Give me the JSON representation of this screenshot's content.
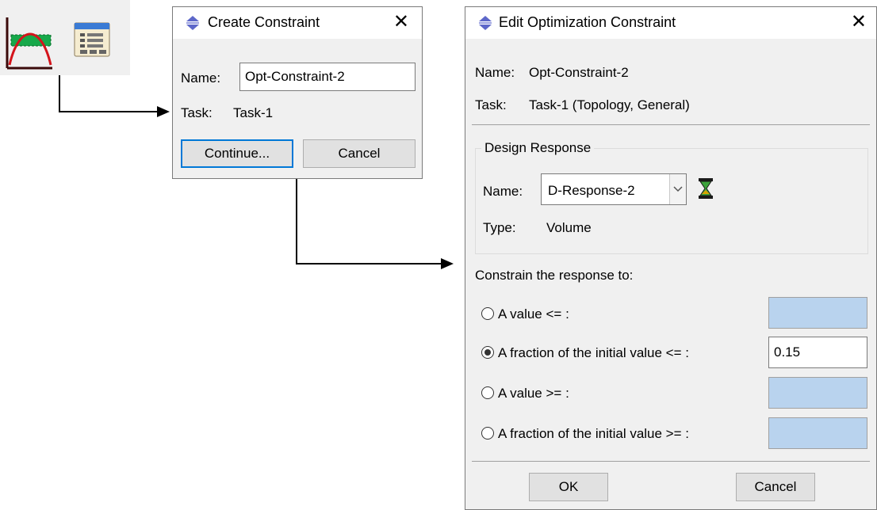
{
  "create_dialog": {
    "title": "Create Constraint",
    "close_glyph": "✕",
    "name_label": "Name:",
    "name_value": "Opt-Constraint-2",
    "task_label": "Task:",
    "task_value": "Task-1",
    "continue_label": "Continue...",
    "cancel_label": "Cancel"
  },
  "edit_dialog": {
    "title": "Edit Optimization Constraint",
    "close_glyph": "✕",
    "name_label": "Name:",
    "name_value": "Opt-Constraint-2",
    "task_label": "Task:",
    "task_value": "Task-1 (Topology, General)",
    "design_response": {
      "group_title": "Design Response",
      "name_label": "Name:",
      "selected": "D-Response-2",
      "type_label": "Type:",
      "type_value": "Volume"
    },
    "constrain_label": "Constrain the response to:",
    "options": [
      {
        "label": "A value <= :",
        "selected": false,
        "value": ""
      },
      {
        "label": "A fraction of the initial value <= :",
        "selected": true,
        "value": "0.15"
      },
      {
        "label": "A value >= :",
        "selected": false,
        "value": ""
      },
      {
        "label": "A fraction of the initial value >= :",
        "selected": false,
        "value": ""
      }
    ],
    "ok_label": "OK",
    "cancel_label": "Cancel"
  },
  "icons": {
    "toolbar": [
      "create-constraint-icon",
      "constraint-manager-icon"
    ],
    "title": "abaqus-logo-icon",
    "response_pick": "hourglass-icon"
  }
}
